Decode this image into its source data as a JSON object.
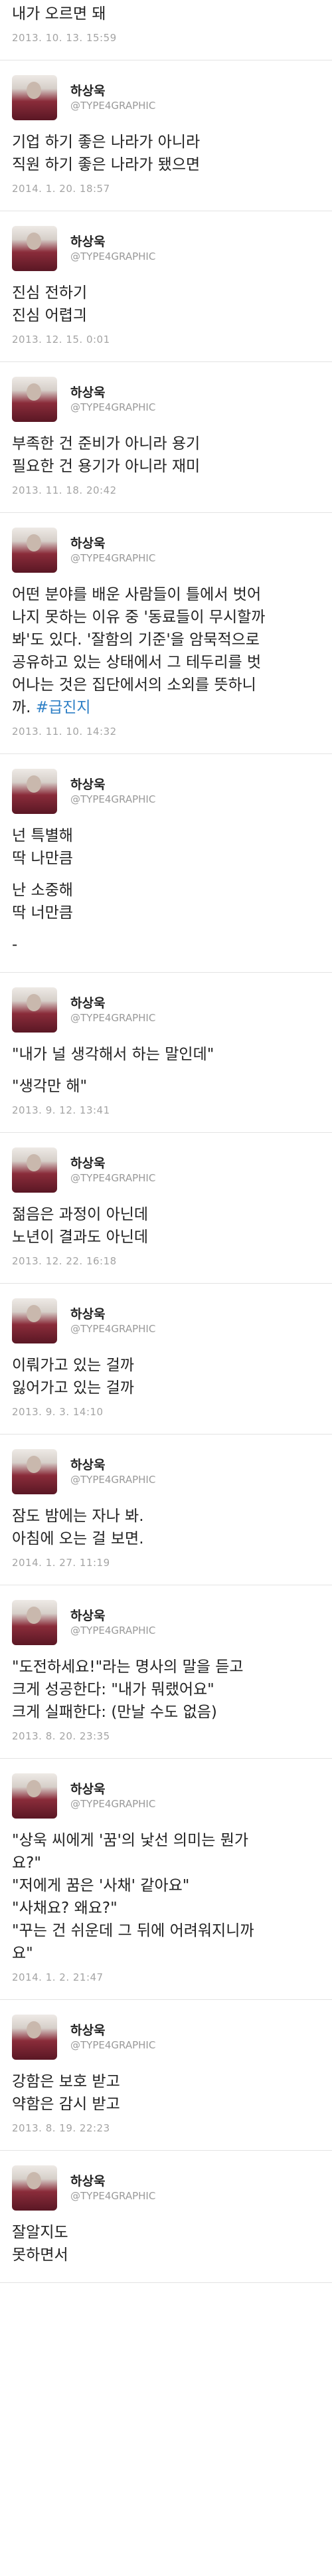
{
  "profile": {
    "name": "하상욱",
    "handle": "@TYPE4GRAPHIC"
  },
  "tweets": [
    {
      "lines": [
        "내가 오르면 돼"
      ],
      "time": "2013. 10. 13. 15:59",
      "has_header": false
    },
    {
      "lines": [
        "기업 하기 좋은 나라가 아니라",
        "직원 하기 좋은 나라가 됐으면"
      ],
      "time": "2014. 1. 20. 18:57"
    },
    {
      "lines": [
        "진심 전하기",
        "진심 어렵긔"
      ],
      "time": "2013. 12. 15. 0:01"
    },
    {
      "lines": [
        "부족한 건 준비가 아니라 용기",
        "필요한 건 용기가 아니라 재미"
      ],
      "time": "2013. 11. 18. 20:42"
    },
    {
      "lines": [
        "어떤 분야를 배운 사람들이 틀에서 벗어",
        "나지 못하는 이유 중 '동료들이 무시할까",
        "봐'도 있다. '잘함의 기준'을 암묵적으로",
        "공유하고 있는 상태에서 그 테두리를 벗",
        "어나는 것은 집단에서의 소외를 뜻하니",
        "까."
      ],
      "hashtag": "#급진지",
      "time": "2013. 11. 10. 14:32"
    },
    {
      "lines": [
        "넌 특별해",
        "딱 나만큼",
        "",
        "난 소중해",
        "딱 너만큼",
        "",
        "-"
      ],
      "time": ""
    },
    {
      "lines": [
        "\"내가 널 생각해서 하는 말인데\"",
        "",
        "\"생각만 해\""
      ],
      "time": "2013. 9. 12. 13:41"
    },
    {
      "lines": [
        "젊음은 과정이 아닌데",
        "노년이 결과도 아닌데"
      ],
      "time": "2013. 12. 22. 16:18"
    },
    {
      "lines": [
        "이뤄가고 있는 걸까",
        "잃어가고 있는 걸까"
      ],
      "time": "2013. 9. 3. 14:10"
    },
    {
      "lines": [
        "잠도 밤에는 자나 봐.",
        "아침에 오는 걸 보면."
      ],
      "time": "2014. 1. 27. 11:19"
    },
    {
      "lines": [
        "\"도전하세요!\"라는 명사의 말을 듣고",
        "크게 성공한다: \"내가 뭐랬어요\"",
        "크게 실패한다: (만날 수도 없음)"
      ],
      "time": "2013. 8. 20. 23:35"
    },
    {
      "lines": [
        "\"상욱 씨에게 '꿈'의 낯선 의미는 뭔가",
        "요?\"",
        "\"저에게 꿈은 '사채' 같아요\"",
        "\"사채요? 왜요?\"",
        "\"꾸는 건 쉬운데 그 뒤에 어려워지니까",
        "요\""
      ],
      "time": "2014. 1. 2. 21:47"
    },
    {
      "lines": [
        "강함은 보호 받고",
        "약함은 감시 받고"
      ],
      "time": "2013. 8. 19. 22:23"
    },
    {
      "lines": [
        "잘알지도",
        "못하면서"
      ],
      "time": ""
    }
  ]
}
